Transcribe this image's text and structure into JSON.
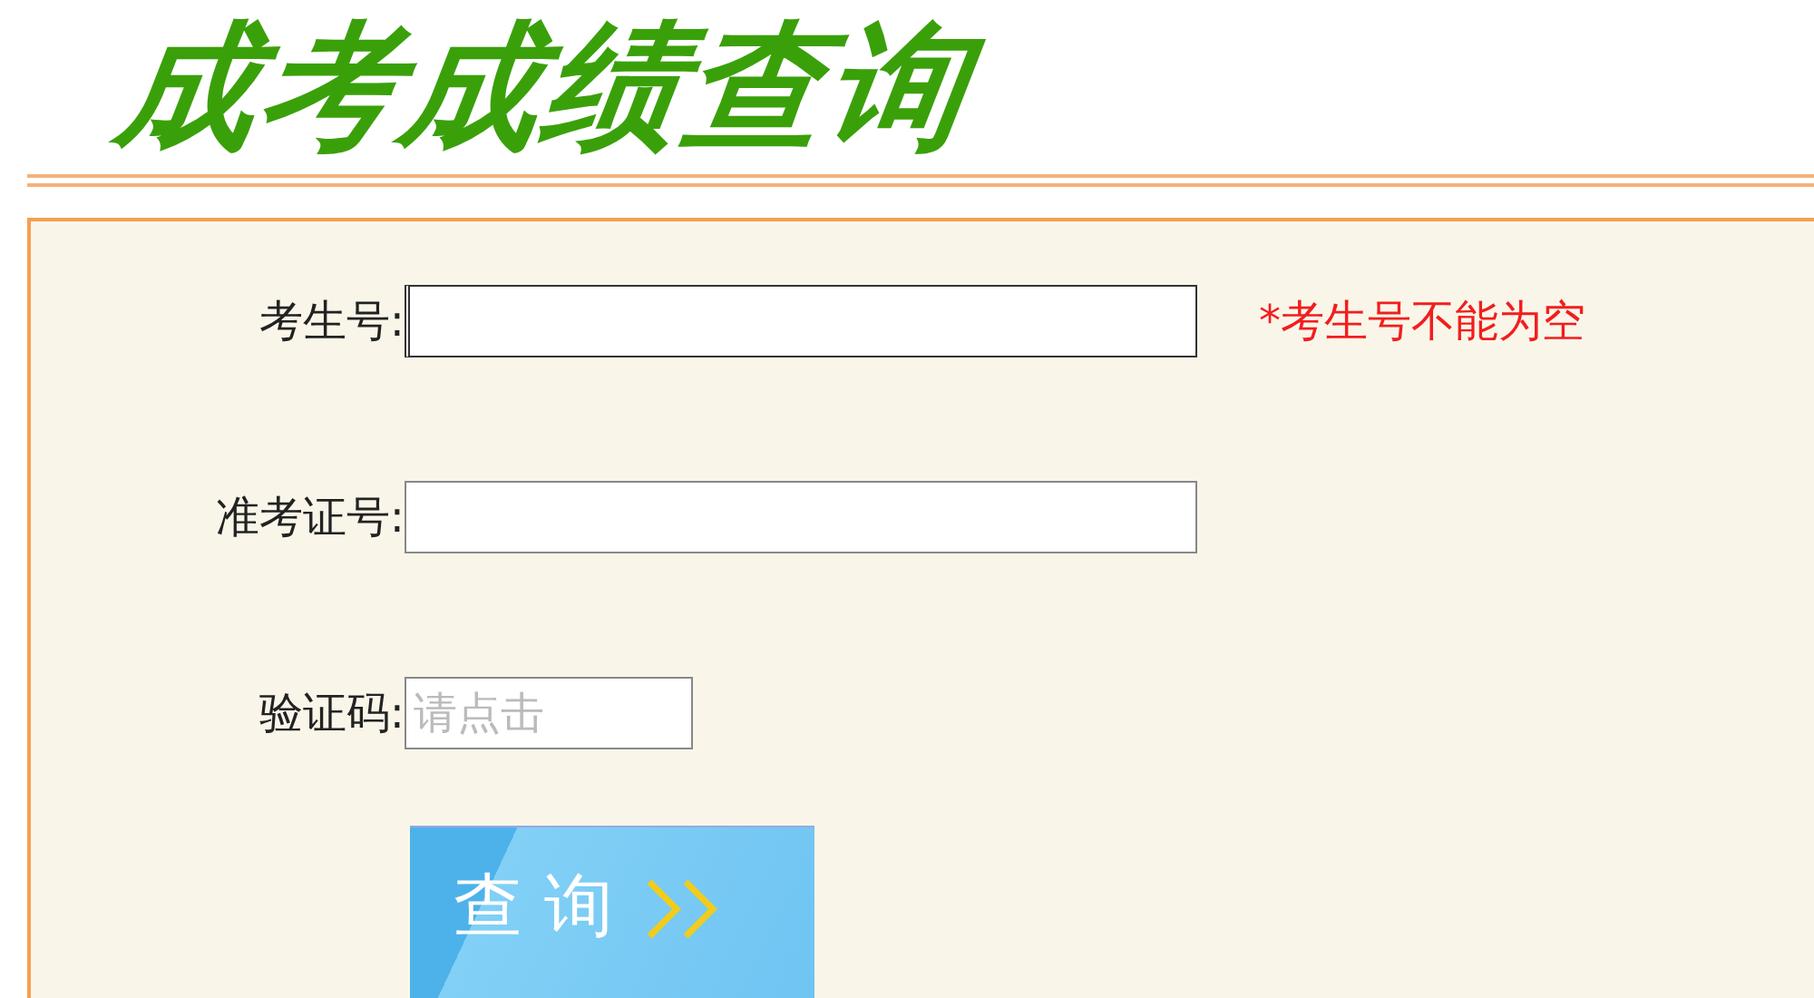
{
  "header": {
    "title": "成考成绩查询"
  },
  "fields": [
    {
      "kind": "text",
      "label": "考生号:",
      "focused": true,
      "error": "*考生号不能为空"
    },
    {
      "kind": "text",
      "label": "准考证号:",
      "focused": false
    },
    {
      "kind": "captcha",
      "label": "验证码:",
      "focused": false,
      "placeholder": "请点击"
    }
  ],
  "submit": {
    "label": "查 询"
  }
}
